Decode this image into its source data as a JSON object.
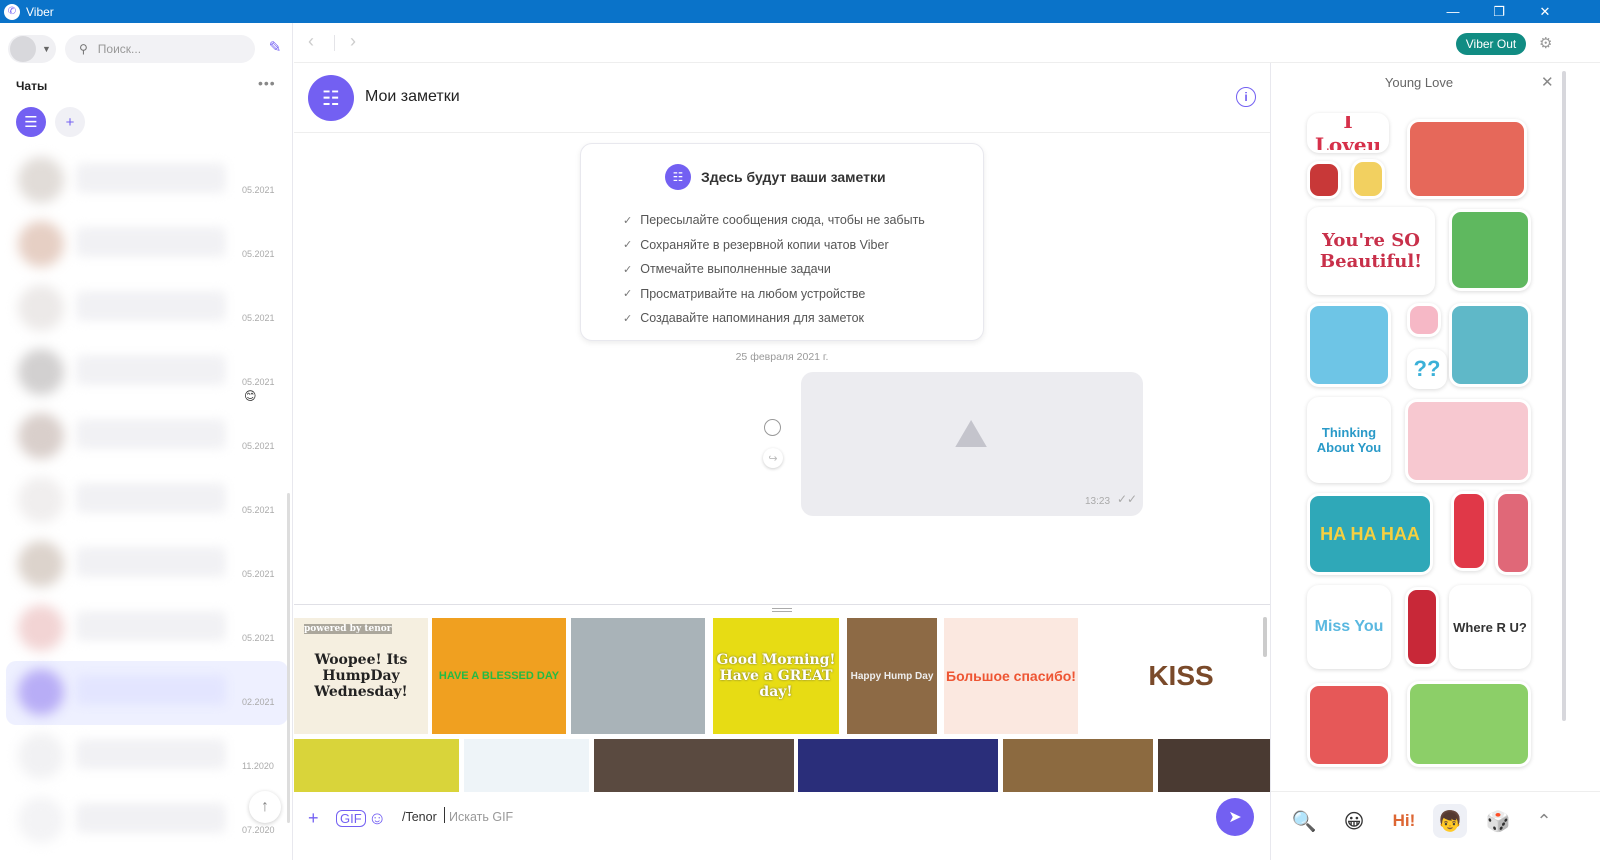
{
  "window": {
    "title": "Viber",
    "minimize": "—",
    "restore": "❐",
    "close": "✕"
  },
  "sidebar": {
    "search_placeholder": "Поиск...",
    "chats_label": "Чаты",
    "more": "•••",
    "chats": [
      {
        "date": "05.2021"
      },
      {
        "date": "05.2021"
      },
      {
        "date": "05.2021"
      },
      {
        "date": "05.2021",
        "emoji": "😊"
      },
      {
        "date": "05.2021"
      },
      {
        "date": "05.2021"
      },
      {
        "date": "05.2021"
      },
      {
        "date": "05.2021"
      },
      {
        "date": "02.2021",
        "active": true
      },
      {
        "date": "11.2020"
      },
      {
        "date": "07.2020"
      }
    ]
  },
  "topbar": {
    "viber_out": "Viber Out"
  },
  "chat": {
    "title": "Мои заметки",
    "notes_card": {
      "heading": "Здесь будут ваши заметки",
      "items": [
        "Пересылайте сообщения сюда, чтобы не забыть",
        "Сохраняйте в резервной копии чатов Viber",
        "Отмечайте выполненные задачи",
        "Просматривайте на любом устройстве",
        "Создавайте напоминания для заметок"
      ]
    },
    "date_separator": "25 февраля 2021 г.",
    "message": {
      "time": "13:23"
    }
  },
  "gifs": {
    "row1": [
      {
        "text": "Woopee! Its HumpDay Wednesday!",
        "overlay": "powered by tenor"
      },
      {
        "text": "HAVE A BLESSED DAY"
      },
      {
        "text": ""
      },
      {
        "text": "Good Morning! Have a GREAT day!"
      },
      {
        "text": "Happy Hump Day"
      },
      {
        "text": "Большое спасибо!"
      },
      {
        "text": "KISS"
      }
    ],
    "row2": [
      {
        "text": ""
      },
      {
        "text": ""
      },
      {
        "text": ""
      },
      {
        "text": ""
      },
      {
        "text": ""
      },
      {
        "text": ""
      }
    ]
  },
  "composer": {
    "command": "/Tenor",
    "placeholder": "Искать GIF"
  },
  "stickers": {
    "pack_title": "Young Love",
    "items": [
      {
        "text": "I Loveu"
      },
      {
        "text": ""
      },
      {
        "text": ""
      },
      {
        "text": ""
      },
      {
        "text": "You're SO Beautiful!"
      },
      {
        "text": ""
      },
      {
        "text": ""
      },
      {
        "text": ""
      },
      {
        "text": "??"
      },
      {
        "text": ""
      },
      {
        "text": "Thinking About You"
      },
      {
        "text": ""
      },
      {
        "text": "HA HA HAA"
      },
      {
        "text": ""
      },
      {
        "text": ""
      },
      {
        "text": "Miss You"
      },
      {
        "text": ""
      },
      {
        "text": "Where R U?"
      },
      {
        "text": ""
      },
      {
        "text": ""
      }
    ],
    "tabs": [
      {
        "glyph": "🔍"
      },
      {
        "glyph": "😀"
      },
      {
        "glyph": "Hi!"
      },
      {
        "glyph": "👦"
      },
      {
        "glyph": "🎲"
      },
      {
        "glyph": "⌃"
      }
    ]
  },
  "colors": {
    "titlebar": "#0a73c9",
    "accent": "#7360f2",
    "viber_out": "#118c83"
  }
}
